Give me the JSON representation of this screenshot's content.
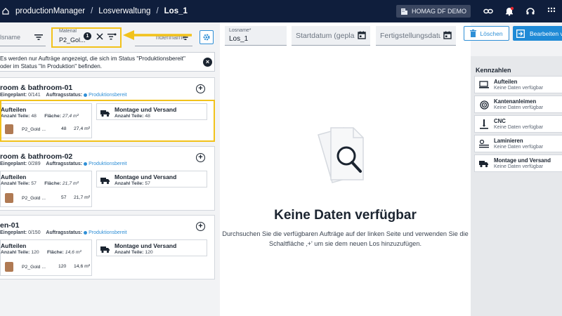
{
  "breadcrumb": {
    "app": "productionManager",
    "section": "Losverwaltung",
    "current": "Los_1"
  },
  "tenant": "HOMAG DF DEMO",
  "filters": {
    "left_placeholder": "lsname",
    "material_label": "Material",
    "material_value": "P2_Gol...",
    "material_count": "1",
    "right_placeholder": "ndenname"
  },
  "info_text": "Es werden nur Aufträge angezeigt, die sich im Status \"Produktionsbereit\" oder im Status \"In Produktion\" befinden.",
  "orders": [
    {
      "title": "room & bathroom-01",
      "planned_label": "Eingeplant:",
      "planned_value": "0/141",
      "status_label": "Auftragsstatus:",
      "status_value": "Produktionsbereit",
      "cut": {
        "title": "Aufteilen",
        "parts_label": "Anzahl Teile:",
        "parts_value": "48",
        "area_label": "Fläche:",
        "area_value": "27,4 m²",
        "material": "P2_Gold ...",
        "mat_count": "48",
        "mat_area": "27,4 m²"
      },
      "ship": {
        "title": "Montage und Versand",
        "parts_label": "Anzahl Teile:",
        "parts_value": "48"
      }
    },
    {
      "title": "room & bathroom-02",
      "planned_label": "Eingeplant:",
      "planned_value": "0/289",
      "status_label": "Auftragsstatus:",
      "status_value": "Produktionsbereit",
      "cut": {
        "title": "Aufteilen",
        "parts_label": "Anzahl Teile:",
        "parts_value": "57",
        "area_label": "Fläche:",
        "area_value": "21,7 m²",
        "material": "P2_Gold ...",
        "mat_count": "57",
        "mat_area": "21,7 m²"
      },
      "ship": {
        "title": "Montage und Versand",
        "parts_label": "Anzahl Teile:",
        "parts_value": "57"
      }
    },
    {
      "title": "en-01",
      "planned_label": "Eingeplant:",
      "planned_value": "0/150",
      "status_label": "Auftragsstatus:",
      "status_value": "Produktionsbereit",
      "cut": {
        "title": "Aufteilen",
        "parts_label": "Anzahl Teile:",
        "parts_value": "120",
        "area_label": "Fläche:",
        "area_value": "14,6 m²",
        "material": "P2_Gold ...",
        "mat_count": "120",
        "mat_area": "14,6 m²"
      },
      "ship": {
        "title": "Montage und Versand",
        "parts_label": "Anzahl Teile:",
        "parts_value": "120"
      }
    }
  ],
  "form": {
    "losname_label": "Losname*",
    "losname_value": "Los_1",
    "start_placeholder": "Startdatum (geplant)",
    "end_placeholder": "Fertigstellungsdatum"
  },
  "empty": {
    "title": "Keine Daten verfügbar",
    "desc_line1": "Durchsuchen Sie die verfügbaren Aufträge auf der linken Seite und verwenden Sie die",
    "desc_line2": "Schaltfläche ‚+' um sie dem neuen Los hinzuzufügen."
  },
  "actions": {
    "delete": "Löschen",
    "edit": "Bearbeiten ve"
  },
  "kennzahlen": {
    "title": "Kennzahlen",
    "items": [
      {
        "title": "Aufteilen",
        "sub": "Keine Daten verfügbar",
        "icon": "saw-icon"
      },
      {
        "title": "Kantenanleimen",
        "sub": "Keine Daten verfügbar",
        "icon": "edge-roll-icon"
      },
      {
        "title": "CNC",
        "sub": "Keine Daten verfügbar",
        "icon": "cnc-icon"
      },
      {
        "title": "Laminieren",
        "sub": "Keine Daten verfügbar",
        "icon": "laminate-icon"
      },
      {
        "title": "Montage und Versand",
        "sub": "Keine Daten verfügbar",
        "icon": "truck-icon"
      }
    ]
  },
  "colors": {
    "topbar": "#0f1e3c",
    "accent": "#1f8ad6",
    "highlight": "#f2c21b"
  }
}
